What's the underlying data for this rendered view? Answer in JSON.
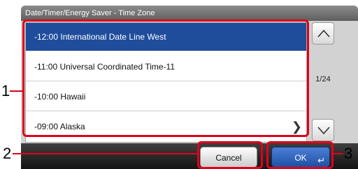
{
  "window": {
    "title": "Date/Timer/Energy Saver - Time Zone"
  },
  "timezones": [
    {
      "label": "-12:00 International Date Line West",
      "selected": true
    },
    {
      "label": "-11:00 Universal Coordinated Time-11",
      "selected": false
    },
    {
      "label": "-10:00 Hawaii",
      "selected": false
    },
    {
      "label": "-09:00 Alaska",
      "selected": false
    }
  ],
  "pagination": {
    "text": "1/24"
  },
  "buttons": {
    "cancel": "Cancel",
    "ok": "OK"
  },
  "callouts": {
    "list": "1",
    "cancel": "2",
    "ok": "3"
  },
  "icons": {
    "scroll_up": "chevron-up-icon",
    "scroll_down": "chevron-down-icon",
    "row_next": "chevron-right-icon",
    "enter": "enter-icon"
  },
  "colors": {
    "selected": "#1f4d9c",
    "highlight": "#e0001a",
    "ok_button": "#2f63bd"
  }
}
